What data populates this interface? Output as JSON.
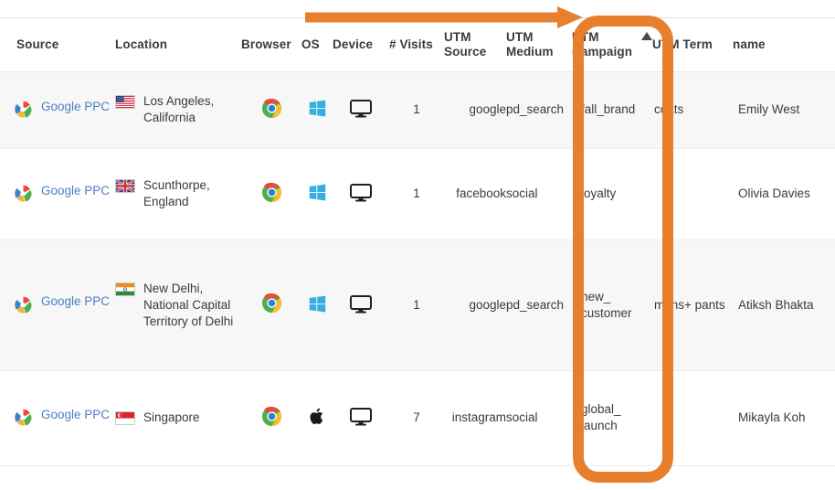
{
  "table": {
    "columns": [
      {
        "key": "source",
        "label": "Source",
        "label2": ""
      },
      {
        "key": "location",
        "label": "Location",
        "label2": ""
      },
      {
        "key": "browser",
        "label": "Browser",
        "label2": ""
      },
      {
        "key": "os",
        "label": "OS",
        "label2": ""
      },
      {
        "key": "device",
        "label": "Device",
        "label2": ""
      },
      {
        "key": "visits",
        "label": "# Visits",
        "label2": ""
      },
      {
        "key": "utm_source",
        "label": "UTM",
        "label2": "Source"
      },
      {
        "key": "utm_medium",
        "label": "UTM",
        "label2": "Medium"
      },
      {
        "key": "utm_campaign",
        "label": "UTM",
        "label2": "Campaign"
      },
      {
        "key": "utm_term",
        "label": "UTM Term",
        "label2": ""
      },
      {
        "key": "name",
        "label": "name",
        "label2": ""
      }
    ],
    "sort": {
      "column": "utm_campaign",
      "direction": "ascending",
      "icon": "sort-ascending-triangle-icon"
    },
    "rows": [
      {
        "source": "Google PPC",
        "source_icon": "google-logo-icon",
        "location": "Los Angeles, California",
        "flag": "flag-united-states-icon",
        "browser_icon": "chrome-icon",
        "os_icon": "windows-icon",
        "device_icon": "desktop-monitor-icon",
        "visits": "1",
        "utm_source": "google",
        "utm_medium": "pd_search",
        "utm_campaign": "fall_brand",
        "utm_term": "coats",
        "name": "Emily West"
      },
      {
        "source": "Google PPC",
        "source_icon": "google-logo-icon",
        "location": "Scunthorpe, England",
        "flag": "flag-united-kingdom-icon",
        "browser_icon": "chrome-icon",
        "os_icon": "windows-icon",
        "device_icon": "desktop-monitor-icon",
        "visits": "1",
        "utm_source": "facebook",
        "utm_medium": "social",
        "utm_campaign": "loyalty",
        "utm_term": "",
        "name": "Olivia Davies"
      },
      {
        "source": "Google PPC",
        "source_icon": "google-logo-icon",
        "location": "New Delhi, National Capital Territory of Delhi",
        "flag": "flag-india-icon",
        "browser_icon": "chrome-icon",
        "os_icon": "windows-icon",
        "device_icon": "desktop-monitor-icon",
        "visits": "1",
        "utm_source": "google",
        "utm_medium": "pd_search",
        "utm_campaign": "new_ customer",
        "utm_term": "mens+ pants",
        "name": "Atiksh Bhakta"
      },
      {
        "source": "Google PPC",
        "source_icon": "google-logo-icon",
        "location": "Singapore",
        "flag": "flag-singapore-icon",
        "browser_icon": "chrome-icon",
        "os_icon": "apple-icon",
        "device_icon": "desktop-monitor-icon",
        "visits": "7",
        "utm_source": "instagram",
        "utm_medium": "social",
        "utm_campaign": "global_ launch",
        "utm_term": "",
        "name": "Mikayla Koh"
      }
    ]
  },
  "annotations": {
    "arrow": {
      "name": "orange-arrow-annotation",
      "color": "#E87F2C"
    },
    "highlight_box": {
      "name": "orange-highlight-box-annotation",
      "color": "#E87F2C",
      "target_column": "UTM Campaign"
    }
  },
  "colors": {
    "accent_orange": "#E87F2C",
    "link_blue": "#4C7FC0",
    "header_gray": "#9A9A9A",
    "row_alt": "#F7F7F7",
    "text": "#3B3B3B"
  }
}
